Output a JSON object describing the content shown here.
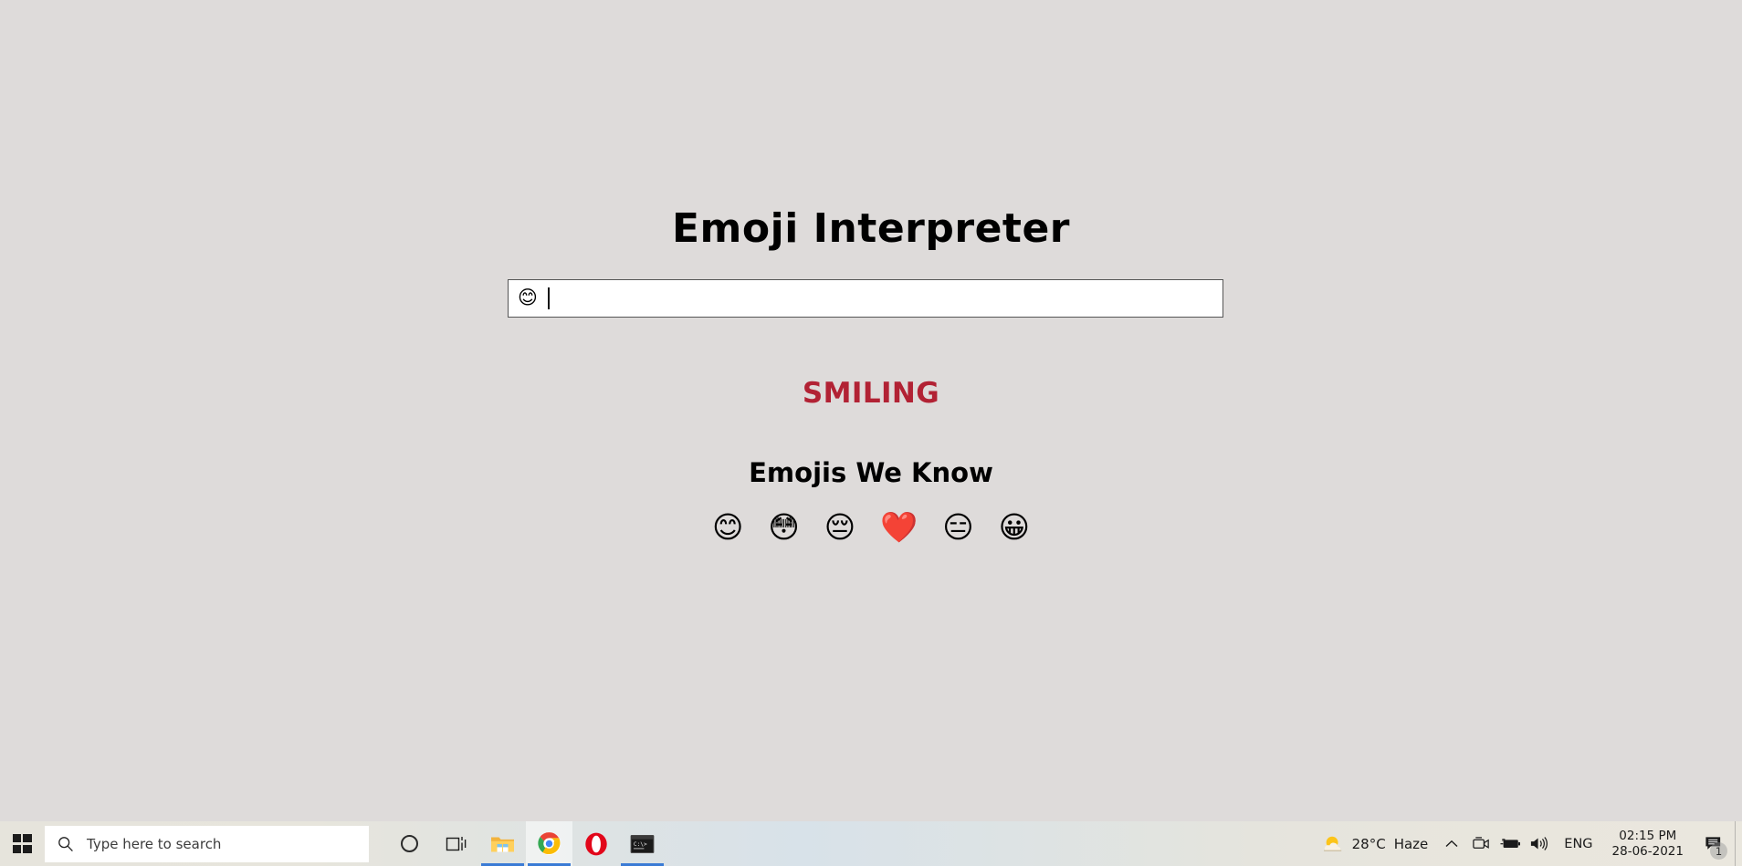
{
  "app": {
    "title": "Emoji Interpreter",
    "input": {
      "value": "😊",
      "placeholder": ""
    },
    "meaning": "SMILING",
    "known_heading": "Emojis We Know",
    "known_emojis": [
      {
        "glyph": "😊",
        "name": "smiling-face-with-smiling-eyes"
      },
      {
        "glyph": "😳",
        "name": "flushed-face"
      },
      {
        "glyph": "😔",
        "name": "pensive-face"
      },
      {
        "glyph": "❤️",
        "name": "red-heart"
      },
      {
        "glyph": "😑",
        "name": "expressionless-face"
      },
      {
        "glyph": "😀",
        "name": "grinning-face"
      }
    ],
    "colors": {
      "background": "#dedbda",
      "title": "#000000",
      "meaning": "#b22234",
      "input_background": "#ffffff",
      "input_border": "#565656"
    }
  },
  "taskbar": {
    "start_label": "Start",
    "search": {
      "placeholder": "Type here to search",
      "icon": "search-icon"
    },
    "apps": [
      {
        "name": "cortana-icon",
        "label": "Cortana",
        "active": false,
        "running": false
      },
      {
        "name": "task-view-icon",
        "label": "Task View",
        "active": false,
        "running": false
      },
      {
        "name": "file-explorer-icon",
        "label": "File Explorer",
        "active": false,
        "running": true
      },
      {
        "name": "google-chrome-icon",
        "label": "Google Chrome",
        "active": true,
        "running": true
      },
      {
        "name": "opera-icon",
        "label": "Opera",
        "active": false,
        "running": false
      },
      {
        "name": "command-prompt-icon",
        "label": "Command Prompt",
        "active": false,
        "running": true
      }
    ],
    "tray": {
      "weather_temp": "28°C",
      "weather_condition": "Haze",
      "weather_icon": "sun-behind-cloud-icon",
      "overflow_icon": "chevron-up-icon",
      "camera_icon": "webcam-icon",
      "battery_icon": "battery-charging-icon",
      "volume_icon": "speaker-icon",
      "language": "ENG",
      "time": "02:15 PM",
      "date": "28-06-2021",
      "notifications_icon": "notifications-icon",
      "notifications_count": "1"
    }
  }
}
